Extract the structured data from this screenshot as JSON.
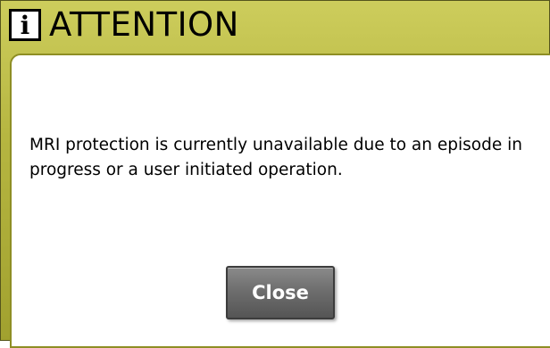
{
  "dialog": {
    "icon": "i",
    "title": "ATTENTION",
    "message": "MRI protection is currently unavailable due to an episode in progress or a user initiated operation.",
    "close_label": "Close"
  },
  "colors": {
    "titlebar": "#b6b641",
    "content_background": "#ffffff",
    "button": "#6e6e6e"
  }
}
